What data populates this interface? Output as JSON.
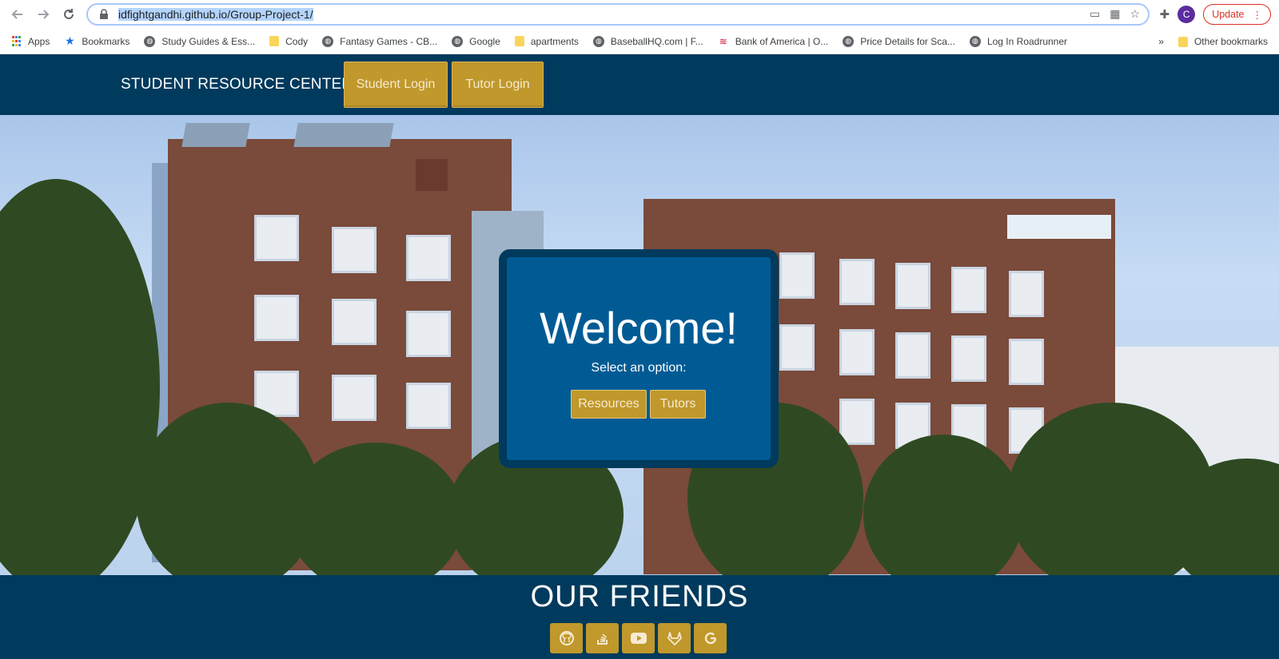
{
  "browser": {
    "url_prefix": "idfightgandhi.github.io/Group-Project-1/",
    "update_label": "Update",
    "profile_initial": "C",
    "bookmarks": [
      {
        "label": "Apps",
        "icon": "apps-icon"
      },
      {
        "label": "Bookmarks",
        "icon": "star-icon"
      },
      {
        "label": "Study Guides & Ess...",
        "icon": "globe-icon"
      },
      {
        "label": "Cody",
        "icon": "folder-icon"
      },
      {
        "label": "Fantasy Games - CB...",
        "icon": "globe-icon"
      },
      {
        "label": "Google",
        "icon": "globe-icon"
      },
      {
        "label": "apartments",
        "icon": "folder-icon"
      },
      {
        "label": "BaseballHQ.com | F...",
        "icon": "globe-icon"
      },
      {
        "label": "Bank of America | O...",
        "icon": "bofa-icon"
      },
      {
        "label": "Price Details for Sca...",
        "icon": "globe-icon"
      },
      {
        "label": "Log In Roadrunner",
        "icon": "globe-icon"
      }
    ],
    "more_label": "»",
    "other_bookmarks": "Other bookmarks"
  },
  "nav": {
    "brand": "STUDENT RESOURCE CENTER",
    "student_login": "Student Login",
    "tutor_login": "Tutor Login"
  },
  "welcome": {
    "title": "Welcome!",
    "subtitle": "Select an option:",
    "resources_label": "Resources",
    "tutors_label": "Tutors"
  },
  "footer": {
    "title": "OUR FRIENDS",
    "social": [
      "github-icon",
      "stackoverflow-icon",
      "youtube-icon",
      "gitlab-icon",
      "google-icon"
    ]
  },
  "colors": {
    "navy": "#003a5d",
    "card_blue": "#005b95",
    "gold": "#c0982b"
  }
}
